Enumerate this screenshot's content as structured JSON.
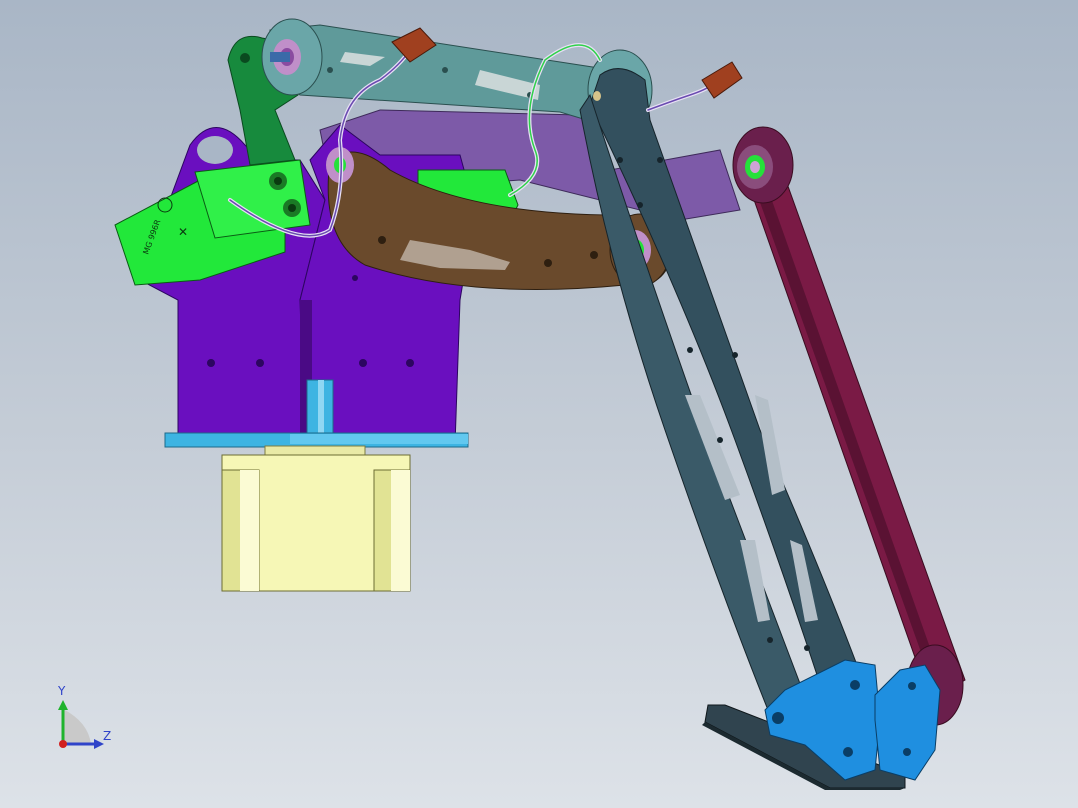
{
  "view": {
    "background_top": "#a9b6c6",
    "background_bottom": "#dde2e8"
  },
  "model": {
    "parts": [
      {
        "name": "stepper-motor",
        "color": "#f6f7b6"
      },
      {
        "name": "base-plate",
        "color": "#3db4e2"
      },
      {
        "name": "servo-mount-brackets",
        "color": "#6a0fbf"
      },
      {
        "name": "servo-motors",
        "color": "#22e83a"
      },
      {
        "name": "upper-arm-link",
        "color": "#5f9a9a"
      },
      {
        "name": "rear-link",
        "color": "#178a3d"
      },
      {
        "name": "lower-arm-link",
        "color": "#6a4a2c"
      },
      {
        "name": "forearm-links",
        "color": "#33505e"
      },
      {
        "name": "parallel-rod",
        "color": "#7a1a45"
      },
      {
        "name": "end-effector-brackets",
        "color": "#1f8fe0"
      },
      {
        "name": "end-plate",
        "color": "#30444f"
      },
      {
        "name": "cable-connectors",
        "color": "#a0401f"
      }
    ],
    "servo_label_text": "MG 996R"
  },
  "triad": {
    "y_label": "Y",
    "z_label": "Z",
    "y_color": "#1fb32c",
    "z_color": "#2f43c9",
    "x_color": "#d21f1f"
  }
}
